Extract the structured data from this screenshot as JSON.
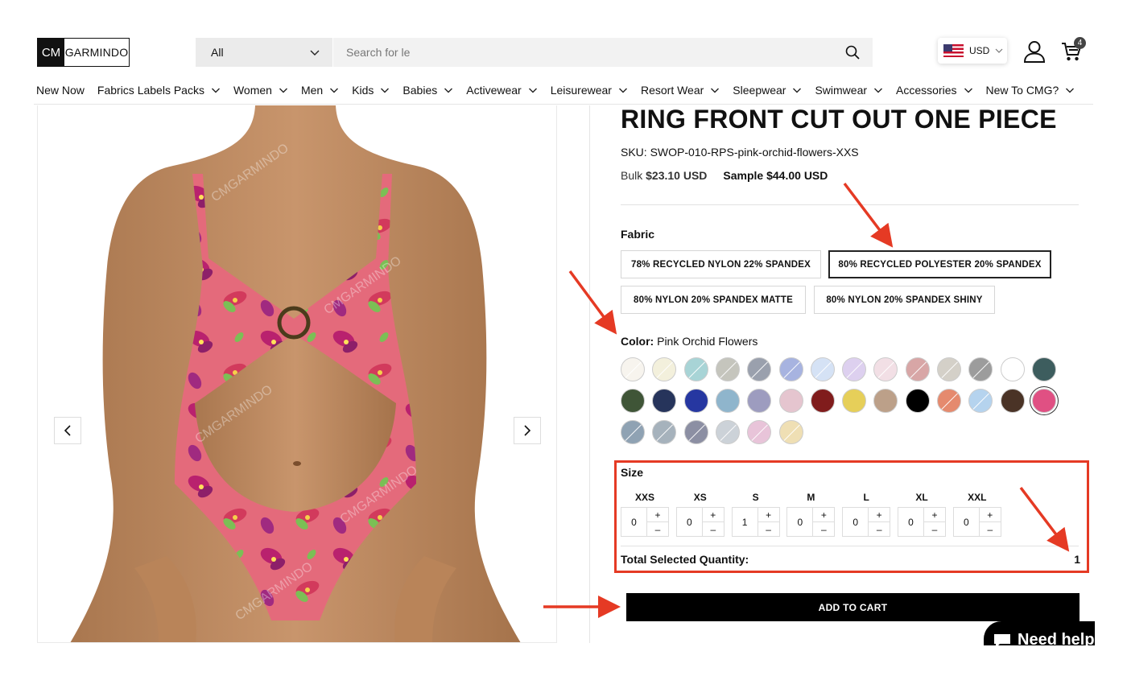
{
  "header": {
    "logo_left": "CM",
    "logo_right": "GARMINDO",
    "search_category": "All",
    "search_placeholder": "Search for le",
    "currency": "USD",
    "cart_count": "4"
  },
  "nav": [
    {
      "label": "New Now",
      "dropdown": false
    },
    {
      "label": "Fabrics Labels Packs",
      "dropdown": true
    },
    {
      "label": "Women",
      "dropdown": true
    },
    {
      "label": "Men",
      "dropdown": true
    },
    {
      "label": "Kids",
      "dropdown": true
    },
    {
      "label": "Babies",
      "dropdown": true
    },
    {
      "label": "Activewear",
      "dropdown": true
    },
    {
      "label": "Leisurewear",
      "dropdown": true
    },
    {
      "label": "Resort Wear",
      "dropdown": true
    },
    {
      "label": "Sleepwear",
      "dropdown": true
    },
    {
      "label": "Swimwear",
      "dropdown": true
    },
    {
      "label": "Accessories",
      "dropdown": true
    },
    {
      "label": "New To CMG?",
      "dropdown": true
    }
  ],
  "product": {
    "title": "RING FRONT CUT OUT ONE PIECE",
    "sku": "SKU: SWOP-010-RPS-pink-orchid-flowers-XXS",
    "bulk_label": "Bulk",
    "bulk_price": "$23.10 USD",
    "sample_label": "Sample",
    "sample_price": "$44.00 USD",
    "watermark": "CMGARMINDO"
  },
  "fabric": {
    "label": "Fabric",
    "options": [
      {
        "label": "78% RECYCLED NYLON 22% SPANDEX",
        "selected": false
      },
      {
        "label": "80% RECYCLED POLYESTER 20% SPANDEX",
        "selected": true
      },
      {
        "label": "80% NYLON 20% SPANDEX MATTE",
        "selected": false
      },
      {
        "label": "80% NYLON 20% SPANDEX SHINY",
        "selected": false
      }
    ]
  },
  "color": {
    "label": "Color:",
    "value": "Pink Orchid Flowers",
    "swatches": [
      {
        "color": "#f7f4ee",
        "available": false
      },
      {
        "color": "#f3f0dc",
        "available": false
      },
      {
        "color": "#a8d4d6",
        "available": false
      },
      {
        "color": "#c5c5bd",
        "available": false
      },
      {
        "color": "#9aa0ad",
        "available": false
      },
      {
        "color": "#a7b3e0",
        "available": false
      },
      {
        "color": "#d5e2f5",
        "available": false
      },
      {
        "color": "#ddd0ef",
        "available": false
      },
      {
        "color": "#f2dfe5",
        "available": false
      },
      {
        "color": "#d8a6a6",
        "available": false
      },
      {
        "color": "#d4d0c8",
        "available": false
      },
      {
        "color": "#9c9c9c",
        "available": false
      },
      {
        "color": "#ffffff",
        "available": true
      },
      {
        "color": "#3d5d5e",
        "available": true
      },
      {
        "color": "#3f5537",
        "available": true
      },
      {
        "color": "#26345b",
        "available": true
      },
      {
        "color": "#2637a1",
        "available": true
      },
      {
        "color": "#8fb5cc",
        "available": true
      },
      {
        "color": "#9d9cbf",
        "available": true
      },
      {
        "color": "#e5c5cf",
        "available": true
      },
      {
        "color": "#801c1c",
        "available": true
      },
      {
        "color": "#e6cf59",
        "available": true
      },
      {
        "color": "#bca089",
        "available": true
      },
      {
        "color": "#000000",
        "available": true
      },
      {
        "color": "#e58a6e",
        "available": false
      },
      {
        "color": "#b5d3ee",
        "available": false
      },
      {
        "color": "#4a3326",
        "available": true
      },
      {
        "color": "#e05083",
        "available": true
      },
      {
        "color": "#8fa2b3",
        "available": false
      },
      {
        "color": "#a6b2bc",
        "available": false
      },
      {
        "color": "#8c8fa3",
        "available": false
      },
      {
        "color": "#ccd2d8",
        "available": false
      },
      {
        "color": "#e8c4d9",
        "available": false
      },
      {
        "color": "#efdfb4",
        "available": false
      }
    ]
  },
  "size": {
    "label": "Size",
    "sizes": [
      {
        "name": "XXS",
        "qty": "0"
      },
      {
        "name": "XS",
        "qty": "0"
      },
      {
        "name": "S",
        "qty": "1"
      },
      {
        "name": "M",
        "qty": "0"
      },
      {
        "name": "L",
        "qty": "0"
      },
      {
        "name": "XL",
        "qty": "0"
      },
      {
        "name": "XXL",
        "qty": "0"
      }
    ],
    "plus": "+",
    "minus": "–",
    "total_label": "Total Selected Quantity:",
    "total_value": "1"
  },
  "add_to_cart": "ADD TO CART",
  "help": "Need help?",
  "accent_colors": {
    "annotation": "#e53a24",
    "button": "#000000"
  }
}
